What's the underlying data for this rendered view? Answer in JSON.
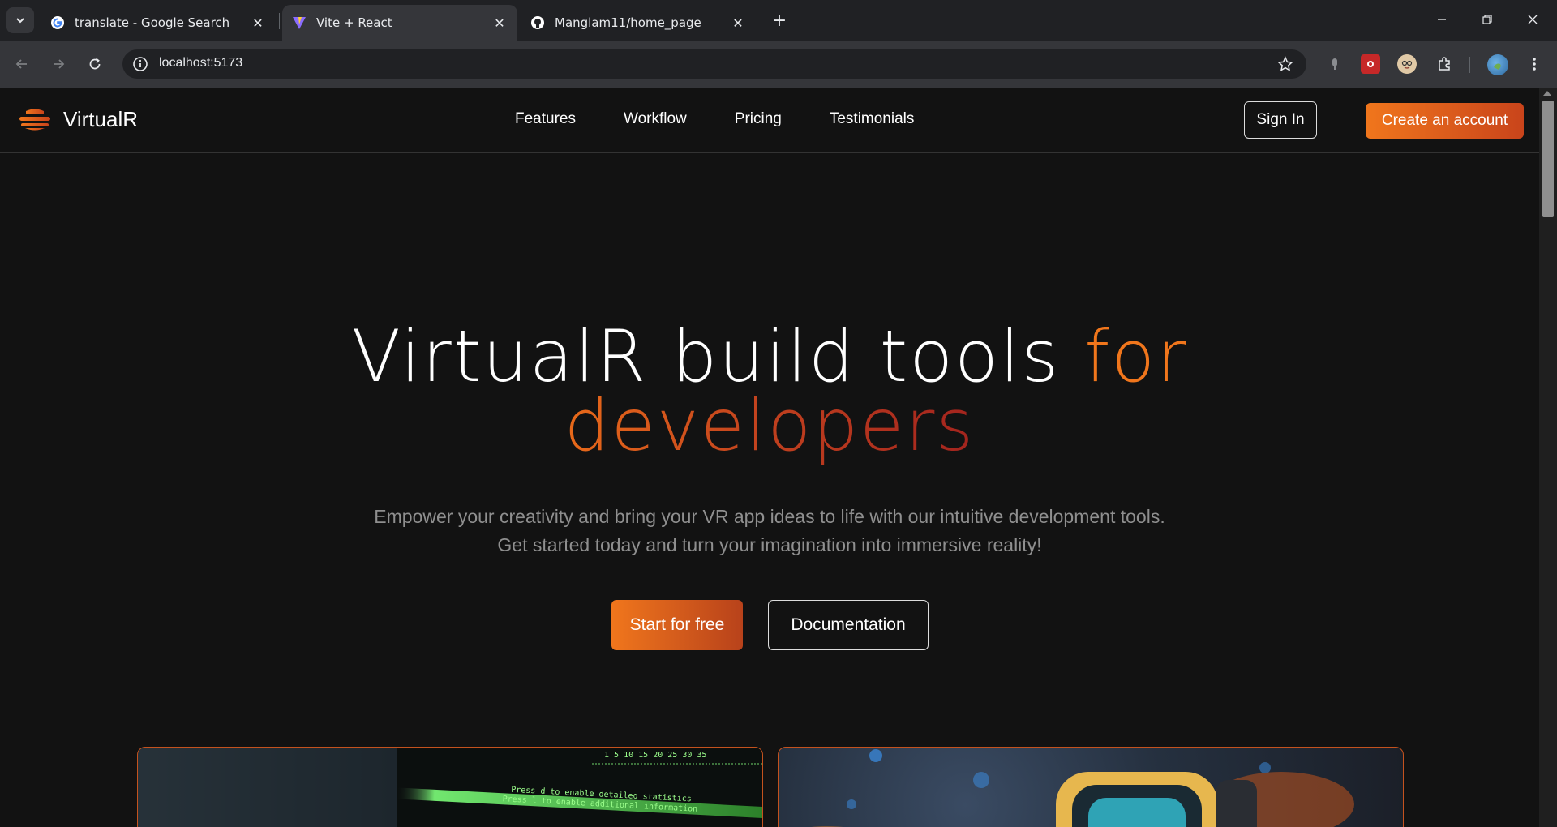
{
  "browser": {
    "tabs": [
      {
        "title": "translate - Google Search",
        "icon": "google-g-icon",
        "active": false
      },
      {
        "title": "Vite + React",
        "icon": "vite-icon",
        "active": true
      },
      {
        "title": "Manglam11/home_page",
        "icon": "github-icon",
        "active": false
      }
    ],
    "url": "localhost:5173"
  },
  "site": {
    "brand": "VirtualR",
    "nav": [
      "Features",
      "Workflow",
      "Pricing",
      "Testimonials"
    ],
    "sign_in": "Sign In",
    "create_account": "Create an account",
    "hero": {
      "title_part1": "VirtualR build tools ",
      "title_part2": "for",
      "title_part3": "developers",
      "subtitle_line1": "Empower your creativity and bring your VR app ideas to life with our intuitive development tools.",
      "subtitle_line2": "Get started today and turn your imagination into immersive reality!"
    },
    "cta_primary": "Start for free",
    "cta_secondary": "Documentation",
    "terminal_lines": [
      "1  5  10  15  20  25  30  35",
      "Press d to enable detailed statistics",
      "Press l to enable additional information"
    ]
  },
  "colors": {
    "accent": "#f0761c",
    "accent_dark": "#b8421b",
    "background": "#121212"
  }
}
